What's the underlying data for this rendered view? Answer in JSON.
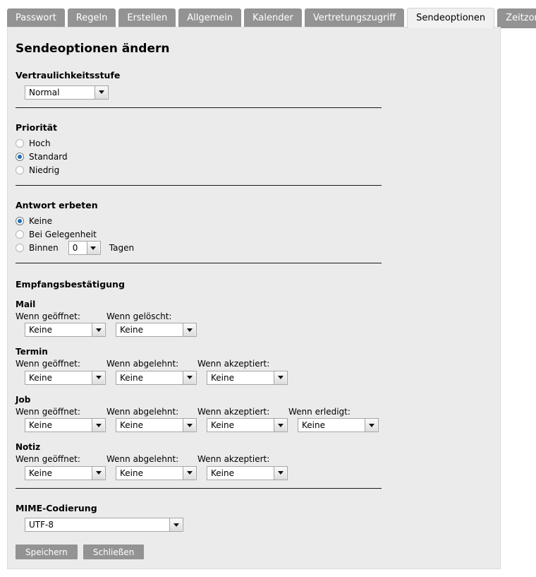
{
  "tabs": [
    {
      "label": "Passwort",
      "active": false
    },
    {
      "label": "Regeln",
      "active": false
    },
    {
      "label": "Erstellen",
      "active": false
    },
    {
      "label": "Allgemein",
      "active": false
    },
    {
      "label": "Kalender",
      "active": false
    },
    {
      "label": "Vertretungszugriff",
      "active": false
    },
    {
      "label": "Sendeoptionen",
      "active": true
    },
    {
      "label": "Zeitzone",
      "active": false
    }
  ],
  "page": {
    "title": "Sendeoptionen ändern"
  },
  "confidentiality": {
    "heading": "Vertraulichkeitsstufe",
    "value": "Normal"
  },
  "priority": {
    "heading": "Priorität",
    "options": [
      {
        "label": "Hoch",
        "checked": false
      },
      {
        "label": "Standard",
        "checked": true
      },
      {
        "label": "Niedrig",
        "checked": false
      }
    ]
  },
  "reply": {
    "heading": "Antwort erbeten",
    "options": [
      {
        "label": "Keine",
        "checked": true
      },
      {
        "label": "Bei Gelegenheit",
        "checked": false
      },
      {
        "label": "Binnen",
        "checked": false
      }
    ],
    "days_value": "0",
    "days_suffix": "Tagen"
  },
  "receipts": {
    "heading": "Empfangsbestätigung",
    "groups": [
      {
        "name": "Mail",
        "fields": [
          {
            "label": "Wenn geöffnet:",
            "value": "Keine"
          },
          {
            "label": "Wenn gelöscht:",
            "value": "Keine"
          }
        ]
      },
      {
        "name": "Termin",
        "fields": [
          {
            "label": "Wenn geöffnet:",
            "value": "Keine"
          },
          {
            "label": "Wenn abgelehnt:",
            "value": "Keine"
          },
          {
            "label": "Wenn akzeptiert:",
            "value": "Keine"
          }
        ]
      },
      {
        "name": "Job",
        "fields": [
          {
            "label": "Wenn geöffnet:",
            "value": "Keine"
          },
          {
            "label": "Wenn abgelehnt:",
            "value": "Keine"
          },
          {
            "label": "Wenn akzeptiert:",
            "value": "Keine"
          },
          {
            "label": "Wenn erledigt:",
            "value": "Keine"
          }
        ]
      },
      {
        "name": "Notiz",
        "fields": [
          {
            "label": "Wenn geöffnet:",
            "value": "Keine"
          },
          {
            "label": "Wenn abgelehnt:",
            "value": "Keine"
          },
          {
            "label": "Wenn akzeptiert:",
            "value": "Keine"
          }
        ]
      }
    ]
  },
  "mime": {
    "heading": "MIME-Codierung",
    "value": "UTF-8"
  },
  "actions": {
    "save_label": "Speichern",
    "close_label": "Schließen"
  },
  "colors": {
    "tab_inactive_bg": "#939393",
    "tab_active_bg": "#f1f1f1",
    "panel_bg": "#ebebeb",
    "button_bg": "#939393",
    "radio_dot": "#1f6fb5"
  }
}
